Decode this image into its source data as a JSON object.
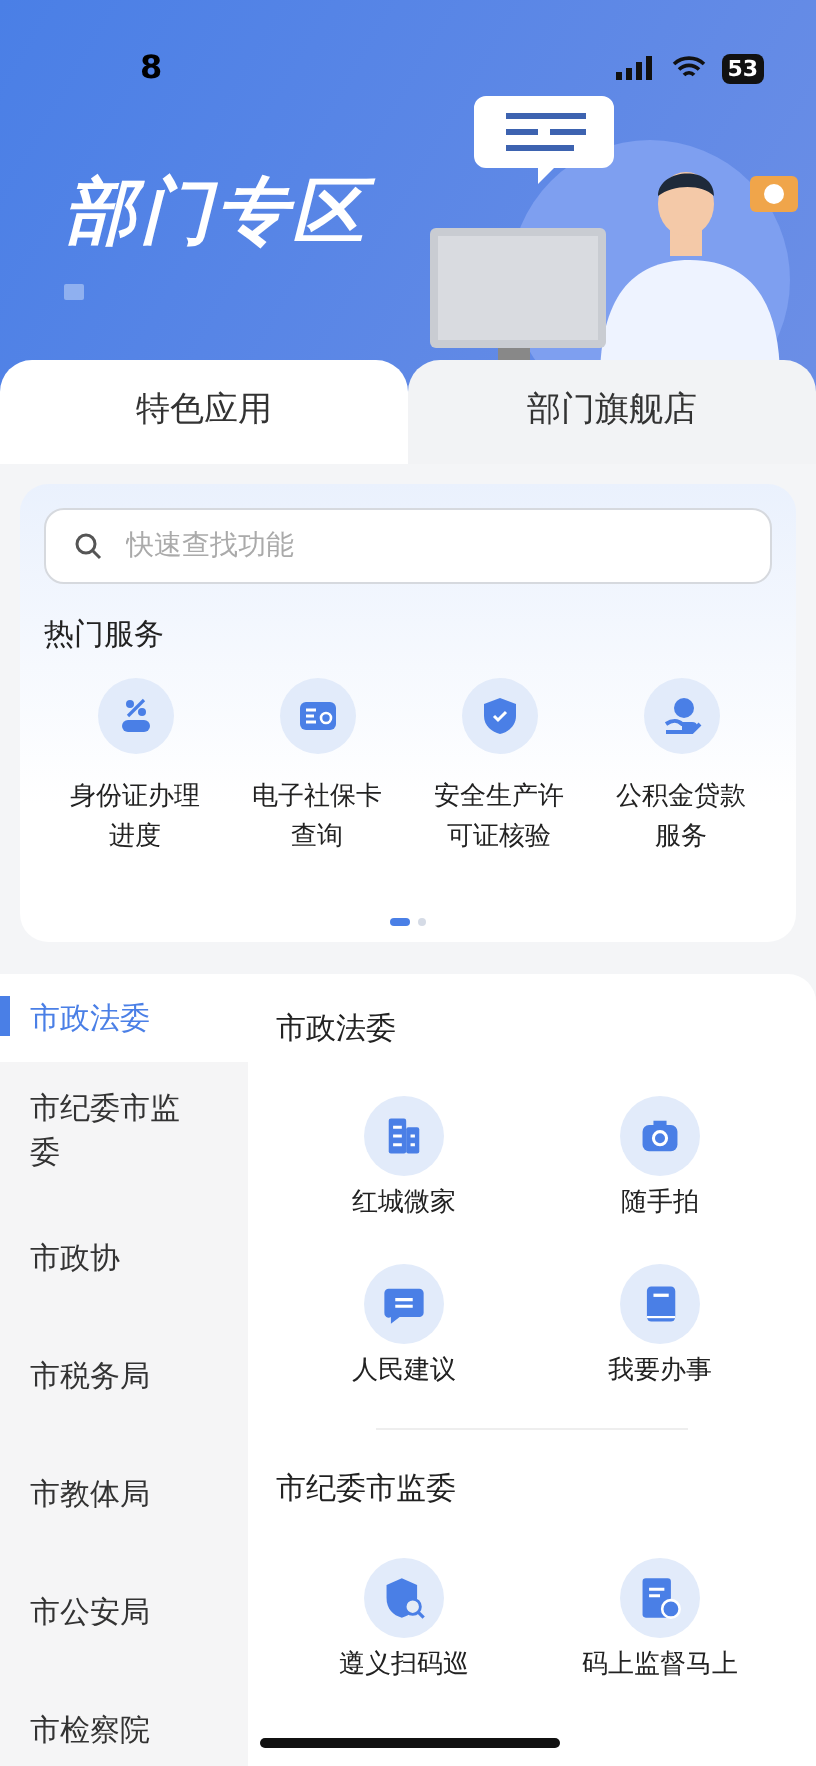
{
  "status_bar": {
    "time": "8",
    "battery": "53"
  },
  "banner": {
    "title": "部门专区"
  },
  "tabs": [
    {
      "label": "特色应用",
      "selected": true
    },
    {
      "label": "部门旗舰店",
      "selected": false
    }
  ],
  "search": {
    "placeholder": "快速查找功能"
  },
  "hot_services": {
    "title": "热门服务",
    "items": [
      {
        "label": "身份证办理进度",
        "kind": "percent"
      },
      {
        "label": "电子社保卡查询",
        "kind": "card"
      },
      {
        "label": "安全生产许可证核验",
        "kind": "shield"
      },
      {
        "label": "公积金贷款服务",
        "kind": "coin"
      }
    ],
    "pages": [
      {
        "selected": true
      },
      {
        "selected": false
      }
    ]
  },
  "sidebar": {
    "items": [
      {
        "label": "市政法委",
        "selected": true
      },
      {
        "label": "市纪委市监委",
        "selected": false
      },
      {
        "label": "市政协",
        "selected": false
      },
      {
        "label": "市税务局",
        "selected": false
      },
      {
        "label": "市教体局",
        "selected": false
      },
      {
        "label": "市公安局",
        "selected": false
      },
      {
        "label": "市检察院",
        "selected": false
      }
    ]
  },
  "sections": [
    {
      "title": "市政法委",
      "items": [
        {
          "label": "红城微家",
          "kind": "building"
        },
        {
          "label": "随手拍",
          "kind": "camera"
        },
        {
          "label": "人民建议",
          "kind": "chat"
        },
        {
          "label": "我要办事",
          "kind": "book"
        }
      ]
    },
    {
      "title": "市纪委市监委",
      "items": [
        {
          "label": "遵义扫码巡",
          "kind": "shield-search"
        },
        {
          "label": "码上监督马上",
          "kind": "doc"
        }
      ]
    }
  ]
}
